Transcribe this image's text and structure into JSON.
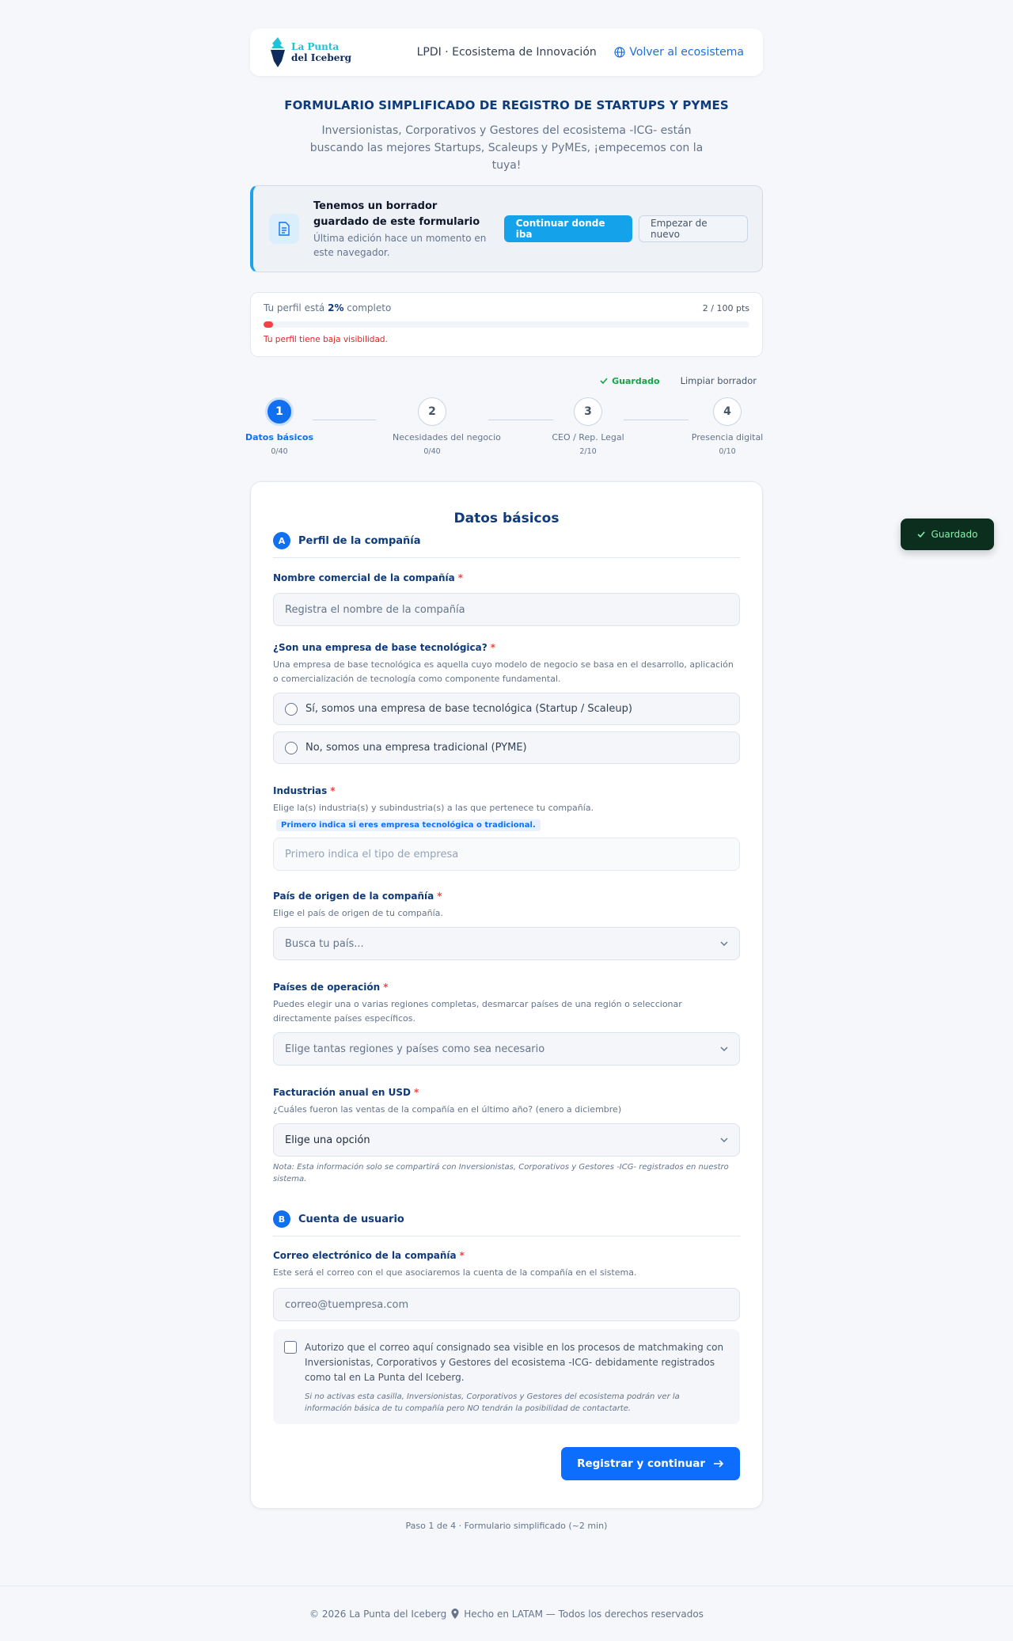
{
  "header": {
    "logo_line1": "La Punta",
    "logo_line2": "del Iceberg",
    "center_text": "LPDI · Ecosistema de Innovación",
    "back_link": "Volver al ecosistema"
  },
  "page": {
    "title": "FORMULARIO SIMPLIFICADO DE REGISTRO DE STARTUPS Y PYMES",
    "subtitle": "Inversionistas, Corporativos y Gestores del ecosistema -ICG- están buscando las mejores Startups, Scaleups y PyMEs, ¡empecemos con la tuya!"
  },
  "draft": {
    "title": "Tenemos un borrador guardado de este formulario",
    "desc": "Última edición hace un momento en este navegador.",
    "continue_label": "Continuar donde iba",
    "restart_label": "Empezar de nuevo"
  },
  "progress": {
    "prefix": "Tu perfil está",
    "percent_label": "2%",
    "suffix": "completo",
    "points": "2 / 100 pts",
    "percent": 2,
    "warning": "Tu perfil tiene baja visibilidad."
  },
  "status": {
    "saved": "Guardado",
    "clear": "Limpiar borrador"
  },
  "steps": [
    {
      "num": "1",
      "label": "Datos básicos",
      "count": "0/40"
    },
    {
      "num": "2",
      "label": "Necesidades del negocio",
      "count": "0/40"
    },
    {
      "num": "3",
      "label": "CEO / Rep. Legal",
      "count": "2/10"
    },
    {
      "num": "4",
      "label": "Presencia digital",
      "count": "0/10"
    }
  ],
  "form": {
    "title": "Datos básicos",
    "sectionA": {
      "badge": "A",
      "title": "Perfil de la compañía"
    },
    "sectionB": {
      "badge": "B",
      "title": "Cuenta de usuario"
    },
    "name": {
      "label": "Nombre comercial de la compañía",
      "placeholder": "Registra el nombre de la compañía"
    },
    "tech": {
      "label": "¿Son una empresa de base tecnológica?",
      "help": "Una empresa de base tecnológica es aquella cuyo modelo de negocio se basa en el desarrollo, aplicación o comercialización de tecnología como componente fundamental.",
      "opt1": "Sí, somos una empresa de base tecnológica (Startup / Scaleup)",
      "opt2": "No, somos una empresa tradicional (PYME)"
    },
    "industries": {
      "label": "Industrias",
      "help": "Elige la(s) industria(s) y subindustria(s) a las que pertenece tu compañía.",
      "chip": "Primero indica si eres empresa tecnológica o tradicional.",
      "placeholder": "Primero indica el tipo de empresa"
    },
    "country": {
      "label": "País de origen de la compañía",
      "help": "Elige el país de origen de tu compañía.",
      "placeholder": "Busca tu país..."
    },
    "operation": {
      "label": "Países de operación",
      "help": "Puedes elegir una o varias regiones completas, desmarcar países de una región o seleccionar directamente países específicos.",
      "placeholder": "Elige tantas regiones y países como sea necesario"
    },
    "revenue": {
      "label": "Facturación anual en USD",
      "help": "¿Cuáles fueron las ventas de la compañía en el último año? (enero a diciembre)",
      "placeholder": "Elige una opción",
      "note": "Nota: Esta información solo se compartirá con Inversionistas, Corporativos y Gestores -ICG- registrados en nuestro sistema."
    },
    "email": {
      "label": "Correo electrónico de la compañía",
      "help": "Este será el correo con el que asociaremos la cuenta de la compañía en el sistema.",
      "placeholder": "correo@tuempresa.com"
    },
    "consent": {
      "text": "Autorizo que el correo aquí consignado sea visible en los procesos de matchmaking con Inversionistas, Corporativos y Gestores del ecosistema -ICG- debidamente registrados como tal en La Punta del Iceberg.",
      "note": "Si no activas esta casilla, Inversionistas, Corporativos y Gestores del ecosistema podrán ver la información básica de tu compañía pero NO tendrán la posibilidad de contactarte."
    },
    "submit": "Registrar y continuar",
    "required_mark": "*"
  },
  "step_footer": "Paso 1 de 4 · Formulario simplificado (~2 min)",
  "footer": {
    "left": "© 2026 La Punta del Iceberg",
    "right": "Hecho en LATAM — Todos los derechos reservados"
  },
  "toast": "Guardado",
  "colors": {
    "primary": "#1170f0",
    "accent": "#14a3ea",
    "danger": "#ef4444",
    "success": "#16a34a",
    "navy": "#0f3b7a"
  }
}
